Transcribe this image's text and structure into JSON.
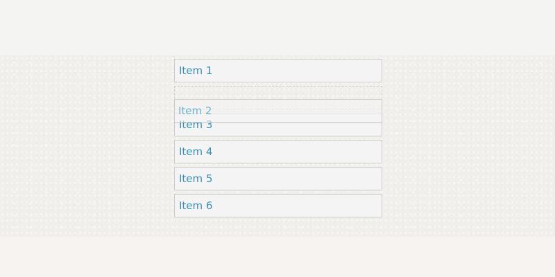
{
  "list": {
    "items": [
      {
        "label": "Item 1"
      },
      {
        "label": "Item 3"
      },
      {
        "label": "Item 4"
      },
      {
        "label": "Item 5"
      },
      {
        "label": "Item 6"
      }
    ],
    "dragging": {
      "label": "Item 2"
    }
  }
}
